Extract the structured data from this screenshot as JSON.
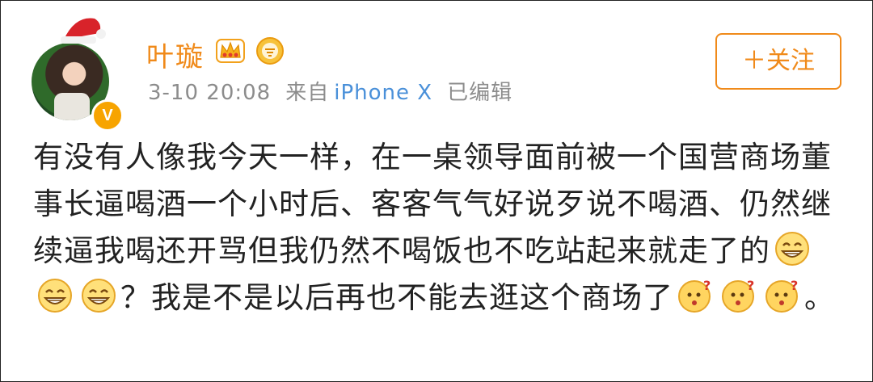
{
  "post": {
    "author": "叶璇",
    "date": "3-10 20:08",
    "source_prefix": "来自",
    "source": "iPhone X",
    "edited": "已编辑",
    "follow_label": "＋关注",
    "verified_badge": "V",
    "badges": [
      "crown-icon",
      "medal-icon"
    ],
    "text_segments": [
      "有没有人像我今天一样，在一桌领导面前被一个国营商场董事长逼喝酒一个小时后、客客气气好说歹说不喝酒、仍然继续逼我喝还开骂但我仍然不喝饭也不吃站起来就走了的",
      "？我是不是以后再也不能去逛这个商场了",
      "。"
    ],
    "emojis": {
      "group1": [
        "grin-emoji",
        "grin-emoji",
        "grin-emoji"
      ],
      "group2": [
        "confused-emoji",
        "confused-emoji",
        "confused-emoji"
      ]
    },
    "colors": {
      "name": "#f08a1a",
      "follow": "#f08a1a",
      "source": "#4a90d9",
      "meta": "#8c8c8c",
      "text": "#222222"
    }
  }
}
